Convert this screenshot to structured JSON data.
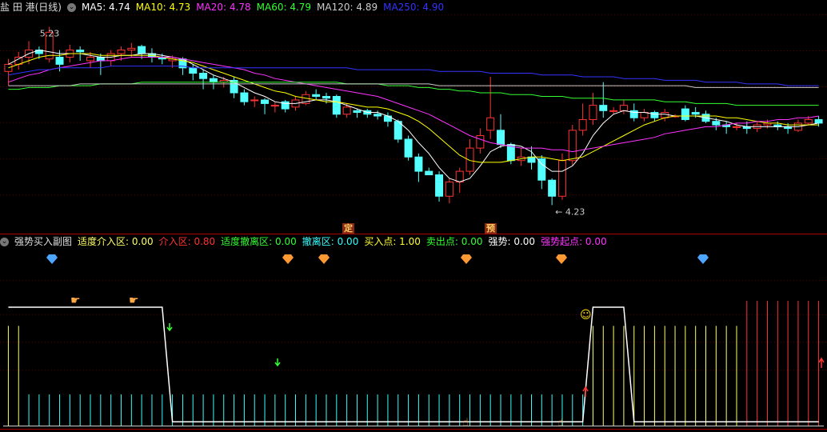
{
  "top_panel": {
    "title": "盐 田 港(日线)",
    "indicators": [
      {
        "label": "MA5: 4.74",
        "color": "#ffffff"
      },
      {
        "label": "MA10: 4.73",
        "color": "#ffff00"
      },
      {
        "label": "MA20: 4.78",
        "color": "#ff33ff"
      },
      {
        "label": "MA60: 4.79",
        "color": "#33ff33"
      },
      {
        "label": "MA120: 4.89",
        "color": "#cccccc"
      },
      {
        "label": "MA250: 4.90",
        "color": "#3333ff"
      }
    ],
    "high_label": "5.23",
    "low_label": "4.23",
    "markers": [
      "定",
      "预"
    ]
  },
  "bottom_panel": {
    "title": "强势买入副图",
    "indicators": [
      {
        "label": "适度介入区: 0.00",
        "color": "#ffff66"
      },
      {
        "label": "介入区: 0.80",
        "color": "#ff3333"
      },
      {
        "label": "适度撤离区: 0.00",
        "color": "#33ff33"
      },
      {
        "label": "撤离区: 0.00",
        "color": "#33ffff"
      },
      {
        "label": "买入点: 1.00",
        "color": "#ffff33"
      },
      {
        "label": "卖出点: 0.00",
        "color": "#33ff33"
      },
      {
        "label": "强势: 0.00",
        "color": "#ffffff"
      },
      {
        "label": "强势起点: 0.00",
        "color": "#ff33ff"
      }
    ]
  },
  "chart_data": {
    "type": "candlestick",
    "candles": [
      {
        "o": 4.98,
        "c": 5.02,
        "h": 5.05,
        "l": 4.9
      },
      {
        "o": 5.02,
        "c": 5.06,
        "h": 5.09,
        "l": 4.99
      },
      {
        "o": 5.06,
        "c": 5.1,
        "h": 5.15,
        "l": 5.02
      },
      {
        "o": 5.1,
        "c": 5.08,
        "h": 5.12,
        "l": 5.05
      },
      {
        "o": 5.05,
        "c": 5.2,
        "h": 5.23,
        "l": 5.03
      },
      {
        "o": 5.06,
        "c": 5.02,
        "h": 5.1,
        "l": 4.98
      },
      {
        "o": 5.06,
        "c": 5.1,
        "h": 5.13,
        "l": 5.03
      },
      {
        "o": 5.1,
        "c": 5.09,
        "h": 5.12,
        "l": 5.04
      },
      {
        "o": 5.04,
        "c": 5.06,
        "h": 5.09,
        "l": 5.0
      },
      {
        "o": 5.06,
        "c": 5.04,
        "h": 5.08,
        "l": 4.96
      },
      {
        "o": 5.04,
        "c": 5.08,
        "h": 5.1,
        "l": 5.01
      },
      {
        "o": 5.08,
        "c": 5.1,
        "h": 5.12,
        "l": 5.04
      },
      {
        "o": 5.1,
        "c": 5.11,
        "h": 5.14,
        "l": 5.06
      },
      {
        "o": 5.12,
        "c": 5.08,
        "h": 5.13,
        "l": 5.05
      },
      {
        "o": 5.08,
        "c": 5.06,
        "h": 5.11,
        "l": 5.03
      },
      {
        "o": 5.06,
        "c": 5.05,
        "h": 5.08,
        "l": 5.02
      },
      {
        "o": 5.04,
        "c": 5.05,
        "h": 5.07,
        "l": 5.0
      },
      {
        "o": 5.05,
        "c": 5.0,
        "h": 5.06,
        "l": 4.96
      },
      {
        "o": 5.0,
        "c": 4.97,
        "h": 5.02,
        "l": 4.93
      },
      {
        "o": 4.97,
        "c": 4.94,
        "h": 4.99,
        "l": 4.88
      },
      {
        "o": 4.94,
        "c": 4.92,
        "h": 4.96,
        "l": 4.88
      },
      {
        "o": 4.92,
        "c": 4.93,
        "h": 4.95,
        "l": 4.89
      },
      {
        "o": 4.93,
        "c": 4.86,
        "h": 4.95,
        "l": 4.83
      },
      {
        "o": 4.86,
        "c": 4.81,
        "h": 4.88,
        "l": 4.79
      },
      {
        "o": 4.82,
        "c": 4.82,
        "h": 4.84,
        "l": 4.78
      },
      {
        "o": 4.82,
        "c": 4.8,
        "h": 4.83,
        "l": 4.74
      },
      {
        "o": 4.79,
        "c": 4.79,
        "h": 4.81,
        "l": 4.75
      },
      {
        "o": 4.81,
        "c": 4.77,
        "h": 4.82,
        "l": 4.75
      },
      {
        "o": 4.78,
        "c": 4.82,
        "h": 4.84,
        "l": 4.76
      },
      {
        "o": 4.8,
        "c": 4.85,
        "h": 4.87,
        "l": 4.79
      },
      {
        "o": 4.85,
        "c": 4.84,
        "h": 4.88,
        "l": 4.82
      },
      {
        "o": 4.84,
        "c": 4.83,
        "h": 4.86,
        "l": 4.8
      },
      {
        "o": 4.84,
        "c": 4.74,
        "h": 4.85,
        "l": 4.72
      },
      {
        "o": 4.74,
        "c": 4.78,
        "h": 4.8,
        "l": 4.72
      },
      {
        "o": 4.76,
        "c": 4.75,
        "h": 4.77,
        "l": 4.72
      },
      {
        "o": 4.76,
        "c": 4.74,
        "h": 4.77,
        "l": 4.72
      },
      {
        "o": 4.74,
        "c": 4.73,
        "h": 4.76,
        "l": 4.71
      },
      {
        "o": 4.73,
        "c": 4.7,
        "h": 4.75,
        "l": 4.67
      },
      {
        "o": 4.7,
        "c": 4.6,
        "h": 4.71,
        "l": 4.58
      },
      {
        "o": 4.6,
        "c": 4.5,
        "h": 4.62,
        "l": 4.48
      },
      {
        "o": 4.5,
        "c": 4.42,
        "h": 4.52,
        "l": 4.36
      },
      {
        "o": 4.42,
        "c": 4.4,
        "h": 4.44,
        "l": 4.4
      },
      {
        "o": 4.4,
        "c": 4.28,
        "h": 4.42,
        "l": 4.25
      },
      {
        "o": 4.28,
        "c": 4.36,
        "h": 4.38,
        "l": 4.24
      },
      {
        "o": 4.36,
        "c": 4.42,
        "h": 4.44,
        "l": 4.3
      },
      {
        "o": 4.42,
        "c": 4.55,
        "h": 4.6,
        "l": 4.4
      },
      {
        "o": 4.55,
        "c": 4.62,
        "h": 4.66,
        "l": 4.52
      },
      {
        "o": 4.65,
        "c": 4.72,
        "h": 4.95,
        "l": 4.6
      },
      {
        "o": 4.65,
        "c": 4.57,
        "h": 4.74,
        "l": 4.55
      },
      {
        "o": 4.57,
        "c": 4.48,
        "h": 4.58,
        "l": 4.46
      },
      {
        "o": 4.48,
        "c": 4.5,
        "h": 4.55,
        "l": 4.45
      },
      {
        "o": 4.5,
        "c": 4.47,
        "h": 4.56,
        "l": 4.43
      },
      {
        "o": 4.49,
        "c": 4.37,
        "h": 4.51,
        "l": 4.32
      },
      {
        "o": 4.37,
        "c": 4.28,
        "h": 4.38,
        "l": 4.23
      },
      {
        "o": 4.28,
        "c": 4.48,
        "h": 4.52,
        "l": 4.26
      },
      {
        "o": 4.48,
        "c": 4.65,
        "h": 4.68,
        "l": 4.45
      },
      {
        "o": 4.65,
        "c": 4.71,
        "h": 4.8,
        "l": 4.62
      },
      {
        "o": 4.71,
        "c": 4.79,
        "h": 4.86,
        "l": 4.68
      },
      {
        "o": 4.79,
        "c": 4.76,
        "h": 4.92,
        "l": 4.72
      },
      {
        "o": 4.76,
        "c": 4.76,
        "h": 4.78,
        "l": 4.74
      },
      {
        "o": 4.76,
        "c": 4.79,
        "h": 4.82,
        "l": 4.74
      },
      {
        "o": 4.76,
        "c": 4.72,
        "h": 4.8,
        "l": 4.7
      },
      {
        "o": 4.72,
        "c": 4.75,
        "h": 4.77,
        "l": 4.7
      },
      {
        "o": 4.75,
        "c": 4.72,
        "h": 4.76,
        "l": 4.7
      },
      {
        "o": 4.72,
        "c": 4.75,
        "h": 4.77,
        "l": 4.7
      },
      {
        "o": 4.73,
        "c": 4.73,
        "h": 4.74,
        "l": 4.72
      },
      {
        "o": 4.77,
        "c": 4.71,
        "h": 4.79,
        "l": 4.7
      },
      {
        "o": 4.75,
        "c": 4.74,
        "h": 4.78,
        "l": 4.72
      },
      {
        "o": 4.74,
        "c": 4.7,
        "h": 4.76,
        "l": 4.69
      },
      {
        "o": 4.7,
        "c": 4.68,
        "h": 4.72,
        "l": 4.65
      },
      {
        "o": 4.68,
        "c": 4.67,
        "h": 4.7,
        "l": 4.63
      },
      {
        "o": 4.67,
        "c": 4.67,
        "h": 4.69,
        "l": 4.65
      },
      {
        "o": 4.67,
        "c": 4.66,
        "h": 4.7,
        "l": 4.63
      },
      {
        "o": 4.66,
        "c": 4.68,
        "h": 4.7,
        "l": 4.64
      },
      {
        "o": 4.68,
        "c": 4.69,
        "h": 4.71,
        "l": 4.66
      },
      {
        "o": 4.68,
        "c": 4.67,
        "h": 4.7,
        "l": 4.65
      },
      {
        "o": 4.67,
        "c": 4.66,
        "h": 4.69,
        "l": 4.63
      },
      {
        "o": 4.65,
        "c": 4.69,
        "h": 4.71,
        "l": 4.64
      },
      {
        "o": 4.69,
        "c": 4.71,
        "h": 4.73,
        "l": 4.68
      },
      {
        "o": 4.71,
        "c": 4.69,
        "h": 4.73,
        "l": 4.67
      }
    ],
    "ma": [
      {
        "name": "MA5",
        "color": "#ffffff",
        "points": [
          5.02,
          5.05,
          5.08,
          5.1,
          5.09,
          5.08,
          5.08,
          5.08,
          5.07,
          5.06,
          5.06,
          5.07,
          5.07,
          5.08,
          5.08,
          5.07,
          5.06,
          5.05,
          5.02,
          4.99,
          4.96,
          4.94,
          4.92,
          4.89,
          4.86,
          4.84,
          4.81,
          4.8,
          4.8,
          4.81,
          4.82,
          4.82,
          4.81,
          4.79,
          4.77,
          4.75,
          4.75,
          4.73,
          4.7,
          4.65,
          4.58,
          4.52,
          4.44,
          4.38,
          4.36,
          4.38,
          4.45,
          4.53,
          4.56,
          4.57,
          4.56,
          4.53,
          4.46,
          4.42,
          4.42,
          4.45,
          4.52,
          4.62,
          4.69,
          4.74,
          4.76,
          4.75,
          4.75,
          4.74,
          4.74,
          4.73,
          4.73,
          4.73,
          4.72,
          4.71,
          4.7,
          4.68,
          4.67,
          4.67,
          4.67,
          4.67,
          4.67,
          4.67,
          4.68,
          4.69
        ]
      },
      {
        "name": "MA10",
        "color": "#ffff00",
        "points": [
          5.0,
          5.02,
          5.04,
          5.06,
          5.07,
          5.07,
          5.08,
          5.08,
          5.08,
          5.07,
          5.07,
          5.07,
          5.07,
          5.07,
          5.07,
          5.06,
          5.05,
          5.04,
          5.03,
          5.01,
          4.99,
          4.97,
          4.95,
          4.93,
          4.91,
          4.89,
          4.87,
          4.86,
          4.84,
          4.83,
          4.82,
          4.81,
          4.81,
          4.8,
          4.79,
          4.78,
          4.78,
          4.77,
          4.75,
          4.73,
          4.7,
          4.66,
          4.61,
          4.56,
          4.51,
          4.48,
          4.47,
          4.47,
          4.47,
          4.48,
          4.49,
          4.5,
          4.5,
          4.49,
          4.48,
          4.49,
          4.5,
          4.53,
          4.56,
          4.59,
          4.62,
          4.65,
          4.68,
          4.7,
          4.72,
          4.73,
          4.73,
          4.73,
          4.73,
          4.73,
          4.72,
          4.72,
          4.71,
          4.7,
          4.69,
          4.69,
          4.68,
          4.68,
          4.68,
          4.68
        ]
      },
      {
        "name": "MA20",
        "color": "#ff33ff",
        "points": [
          4.92,
          4.94,
          4.96,
          4.97,
          4.99,
          5.0,
          5.01,
          5.02,
          5.03,
          5.04,
          5.04,
          5.05,
          5.06,
          5.06,
          5.06,
          5.06,
          5.06,
          5.05,
          5.04,
          5.03,
          5.02,
          5.01,
          5.0,
          4.99,
          4.97,
          4.96,
          4.94,
          4.93,
          4.92,
          4.91,
          4.9,
          4.89,
          4.88,
          4.87,
          4.86,
          4.85,
          4.84,
          4.82,
          4.8,
          4.78,
          4.76,
          4.74,
          4.71,
          4.68,
          4.65,
          4.62,
          4.6,
          4.58,
          4.57,
          4.56,
          4.55,
          4.55,
          4.55,
          4.54,
          4.54,
          4.53,
          4.54,
          4.55,
          4.56,
          4.57,
          4.58,
          4.59,
          4.6,
          4.61,
          4.63,
          4.64,
          4.65,
          4.66,
          4.67,
          4.67,
          4.68,
          4.69,
          4.69,
          4.7,
          4.7,
          4.71,
          4.71,
          4.72,
          4.72,
          4.73
        ]
      },
      {
        "name": "MA60",
        "color": "#33ff33",
        "points": [
          4.88,
          4.88,
          4.89,
          4.89,
          4.89,
          4.9,
          4.9,
          4.9,
          4.9,
          4.91,
          4.91,
          4.91,
          4.91,
          4.92,
          4.92,
          4.92,
          4.92,
          4.92,
          4.92,
          4.92,
          4.92,
          4.92,
          4.92,
          4.92,
          4.92,
          4.92,
          4.92,
          4.92,
          4.92,
          4.92,
          4.92,
          4.92,
          4.92,
          4.91,
          4.91,
          4.91,
          4.91,
          4.9,
          4.9,
          4.9,
          4.89,
          4.89,
          4.88,
          4.88,
          4.87,
          4.87,
          4.86,
          4.86,
          4.86,
          4.85,
          4.85,
          4.85,
          4.84,
          4.84,
          4.84,
          4.83,
          4.83,
          4.83,
          4.83,
          4.82,
          4.82,
          4.82,
          4.82,
          4.82,
          4.81,
          4.81,
          4.81,
          4.8,
          4.8,
          4.8,
          4.8,
          4.79,
          4.79,
          4.79,
          4.79,
          4.79,
          4.79,
          4.79,
          4.79,
          4.79
        ]
      },
      {
        "name": "MA120",
        "color": "#cccccc",
        "points": [
          4.9,
          4.9,
          4.9,
          4.9,
          4.9,
          4.9,
          4.9,
          4.91,
          4.91,
          4.91,
          4.91,
          4.91,
          4.91,
          4.91,
          4.91,
          4.91,
          4.91,
          4.91,
          4.91,
          4.91,
          4.91,
          4.91,
          4.91,
          4.91,
          4.91,
          4.91,
          4.91,
          4.91,
          4.91,
          4.91,
          4.91,
          4.91,
          4.91,
          4.91,
          4.91,
          4.91,
          4.91,
          4.91,
          4.91,
          4.91,
          4.91,
          4.91,
          4.9,
          4.9,
          4.9,
          4.9,
          4.9,
          4.9,
          4.9,
          4.9,
          4.9,
          4.9,
          4.9,
          4.9,
          4.9,
          4.9,
          4.9,
          4.9,
          4.9,
          4.9,
          4.9,
          4.9,
          4.9,
          4.9,
          4.9,
          4.9,
          4.9,
          4.89,
          4.89,
          4.89,
          4.89,
          4.89,
          4.89,
          4.89,
          4.89,
          4.89,
          4.89,
          4.89,
          4.89,
          4.89
        ]
      },
      {
        "name": "MA250",
        "color": "#3333ff",
        "points": [
          4.96,
          4.97,
          4.98,
          4.99,
          4.99,
          5.0,
          5.0,
          5.0,
          5.0,
          5.0,
          5.01,
          5.01,
          5.01,
          5.01,
          5.01,
          5.01,
          5.01,
          5.01,
          5.0,
          5.0,
          5.0,
          5.0,
          5.0,
          5.0,
          5.0,
          5.0,
          5.0,
          5.0,
          5.0,
          5.0,
          5.0,
          5.0,
          5.0,
          5.0,
          4.99,
          4.99,
          4.99,
          4.99,
          4.99,
          4.99,
          4.99,
          4.99,
          4.98,
          4.98,
          4.98,
          4.98,
          4.98,
          4.97,
          4.97,
          4.97,
          4.97,
          4.97,
          4.96,
          4.96,
          4.96,
          4.96,
          4.95,
          4.95,
          4.95,
          4.95,
          4.94,
          4.94,
          4.94,
          4.94,
          4.93,
          4.93,
          4.93,
          4.93,
          4.92,
          4.92,
          4.92,
          4.92,
          4.91,
          4.91,
          4.91,
          4.91,
          4.9,
          4.9,
          4.9,
          4.9
        ]
      }
    ],
    "ylim": [
      4.16,
      5.3
    ],
    "sub_ylim": [
      0,
      1.2
    ],
    "strength_line": [
      1,
      1,
      1,
      1,
      1,
      1,
      1,
      1,
      1,
      1,
      1,
      1,
      1,
      1,
      1,
      1,
      0,
      0,
      0,
      0,
      0,
      0,
      0,
      0,
      0,
      0,
      0,
      0,
      0,
      0,
      0,
      0,
      0,
      0,
      0,
      0,
      0,
      0,
      0,
      0,
      0,
      0,
      0,
      0,
      0,
      0,
      0,
      0,
      0,
      0,
      0,
      0,
      0,
      0,
      0,
      0,
      0,
      1,
      1,
      1,
      1,
      0,
      0,
      0,
      0,
      0,
      0,
      0,
      0,
      0,
      0,
      0,
      0,
      0,
      0,
      0,
      0,
      0,
      0,
      0
    ],
    "sub_bars": [
      {
        "from": 0,
        "to": 1,
        "v": 0.8,
        "color": "#ffff66"
      },
      {
        "from": 2,
        "to": 56,
        "v": 0.25,
        "color": "#33ffff"
      },
      {
        "from": 57,
        "to": 71,
        "v": 0.8,
        "color": "#ffff66"
      },
      {
        "from": 72,
        "to": 79,
        "v": 1.0,
        "color": "#ff3333"
      }
    ]
  }
}
